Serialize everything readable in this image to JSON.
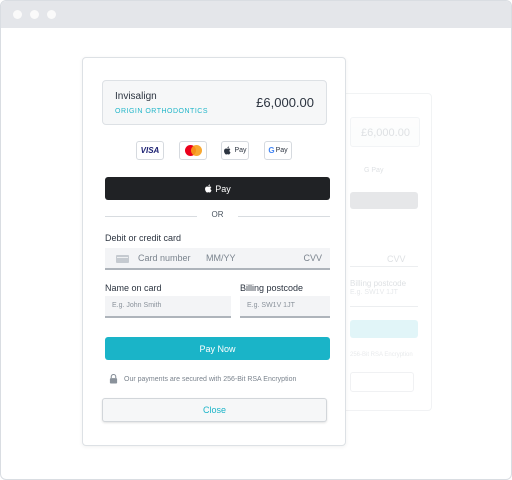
{
  "colors": {
    "accent": "#1ab4c8",
    "apple_pay_button": "#202225",
    "clinic_name": "#22b6c9",
    "browser_bar": "#e4e6ea"
  },
  "summary": {
    "title": "Invisalign",
    "subtitle": "ORIGIN ORTHODONTICS",
    "amount": "£6,000.00"
  },
  "payment_methods": {
    "visa_label": "VISA",
    "apple_pay_label": "Pay",
    "google_pay_label": "Pay",
    "google_g": "G",
    "icons": [
      "visa-icon",
      "mastercard-icon",
      "apple-pay-icon",
      "google-pay-icon"
    ]
  },
  "apple_pay_button": {
    "label": "Pay"
  },
  "divider": {
    "text": "OR"
  },
  "card": {
    "label": "Debit or credit card",
    "number_placeholder": "Card number",
    "expiry_placeholder": "MM/YY",
    "cvv_placeholder": "CVV"
  },
  "name_on_card": {
    "label": "Name on card",
    "placeholder": "E.g. John Smith"
  },
  "billing_postcode": {
    "label": "Billing postcode",
    "placeholder": "E.g. SW1V 1JT"
  },
  "pay_now_button": {
    "label": "Pay Now"
  },
  "secure_note": {
    "text": "Our payments are secured with 256-Bit RSA Encryption"
  },
  "close_button": {
    "label": "Close"
  },
  "background_card": {
    "amount": "£6,000.00",
    "google_pay_label": "G Pay",
    "cvv": "CVV",
    "postcode_label": "Billing postcode",
    "postcode_placeholder": "E.g. SW1V 1JT",
    "secure_fragment": "256-Bit RSA Encryption"
  }
}
